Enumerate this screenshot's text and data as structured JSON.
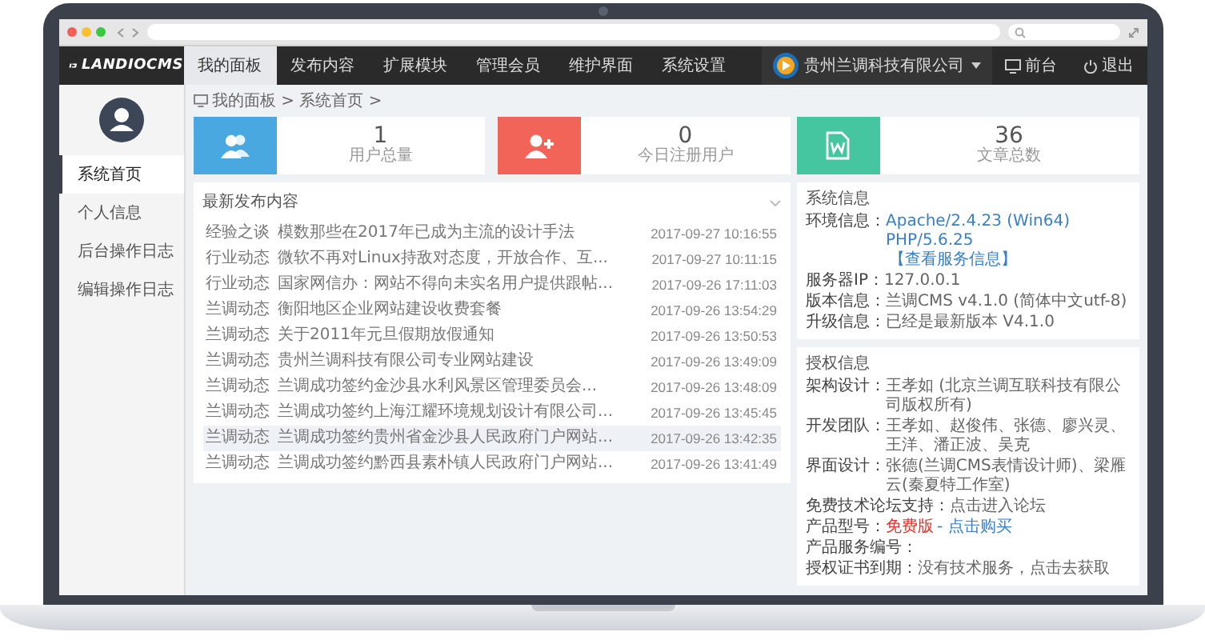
{
  "nav": {
    "logo": "LANDIOCMS",
    "tabs": [
      {
        "label": "我的面板",
        "selected": true
      },
      {
        "label": "发布内容",
        "selected": false
      },
      {
        "label": "扩展模块",
        "selected": false
      },
      {
        "label": "管理会员",
        "selected": false
      },
      {
        "label": "维护界面",
        "selected": false
      },
      {
        "label": "系统设置",
        "selected": false
      }
    ],
    "company": "贵州兰调科技有限公司",
    "actions": [
      {
        "label": "前台",
        "kind": "monitor"
      },
      {
        "label": "退出",
        "kind": "power"
      }
    ]
  },
  "sidebar": {
    "items": [
      {
        "label": "系统首页",
        "selected": true
      },
      {
        "label": "个人信息",
        "selected": false
      },
      {
        "label": "后台操作日志",
        "selected": false
      },
      {
        "label": "编辑操作日志",
        "selected": false
      }
    ]
  },
  "breadcrumb": "我的面板 > 系统首页 >",
  "stats": [
    {
      "kind": "users",
      "value": "1",
      "label": "用户总量",
      "color": "#4aa8e0"
    },
    {
      "kind": "add-user",
      "value": "0",
      "label": "今日注册用户",
      "color": "#f26457"
    },
    {
      "kind": "document",
      "value": "36",
      "label": "文章总数",
      "color": "#45c6a0"
    }
  ],
  "latest": {
    "title": "最新发布内容",
    "rows": [
      {
        "category": "经验之谈",
        "title": "模数那些在2017年已成为主流的设计手法",
        "time": "2017-09-27 10:16:55",
        "highlighted": false
      },
      {
        "category": "行业动态",
        "title": "微软不再对Linux持敌对态度，开放合作、互...",
        "time": "2017-09-27 10:11:15",
        "highlighted": false
      },
      {
        "category": "行业动态",
        "title": "国家网信办：网站不得向未实名用户提供跟帖...",
        "time": "2017-09-26 17:11:03",
        "highlighted": false
      },
      {
        "category": "兰调动态",
        "title": "衡阳地区企业网站建设收费套餐",
        "time": "2017-09-26 13:54:29",
        "highlighted": false
      },
      {
        "category": "兰调动态",
        "title": "关于2011年元旦假期放假通知",
        "time": "2017-09-26 13:50:53",
        "highlighted": false
      },
      {
        "category": "兰调动态",
        "title": "贵州兰调科技有限公司专业网站建设",
        "time": "2017-09-26 13:49:09",
        "highlighted": false
      },
      {
        "category": "兰调动态",
        "title": "兰调成功签约金沙县水利风景区管理委员会...",
        "time": "2017-09-26 13:48:09",
        "highlighted": false
      },
      {
        "category": "兰调动态",
        "title": "兰调成功签约上海江耀环境规划设计有限公司...",
        "time": "2017-09-26 13:45:45",
        "highlighted": false
      },
      {
        "category": "兰调动态",
        "title": "兰调成功签约贵州省金沙县人民政府门户网站...",
        "time": "2017-09-26 13:42:35",
        "highlighted": true
      },
      {
        "category": "兰调动态",
        "title": "兰调成功签约黔西县素朴镇人民政府门户网站...",
        "time": "2017-09-26 13:41:49",
        "highlighted": false
      }
    ]
  },
  "system_info": {
    "title": "系统信息",
    "rows": [
      {
        "label": "环境信息：",
        "value": "Apache/2.4.23 (Win64) PHP/5.6.25",
        "kind": "link",
        "note": "【查看服务信息】"
      },
      {
        "label": "服务器IP：",
        "value": "127.0.0.1",
        "kind": "plain"
      },
      {
        "label": "版本信息：",
        "value": "兰调CMS v4.1.0 (简体中文utf-8)",
        "kind": "plain"
      },
      {
        "label": "升级信息：",
        "value": "已经是最新版本 V4.1.0",
        "kind": "plain"
      }
    ]
  },
  "license_info": {
    "title": "授权信息",
    "rows": [
      {
        "label": "架构设计：",
        "value": "王孝如 (北京兰调互联科技有限公司版权所有)",
        "kind": "plain"
      },
      {
        "label": "开发团队：",
        "value": "王孝如、赵俊伟、张德、廖兴灵、王洋、潘正波、吴克",
        "kind": "plain"
      },
      {
        "label": "界面设计：",
        "value": "张德(兰调CMS表情设计师)、梁雁云(秦夏特工作室)",
        "kind": "plain"
      },
      {
        "label": "免费技术论坛支持：",
        "value": "点击进入论坛",
        "kind": "plain"
      },
      {
        "label": "产品型号：",
        "value": "免费版",
        "kind": "alert",
        "note": "- 点击购买"
      },
      {
        "label": "产品服务编号：",
        "kind": "plain"
      },
      {
        "label": "授权证书到期：",
        "value": "没有技术服务，点击去获取",
        "kind": "plain"
      }
    ]
  }
}
